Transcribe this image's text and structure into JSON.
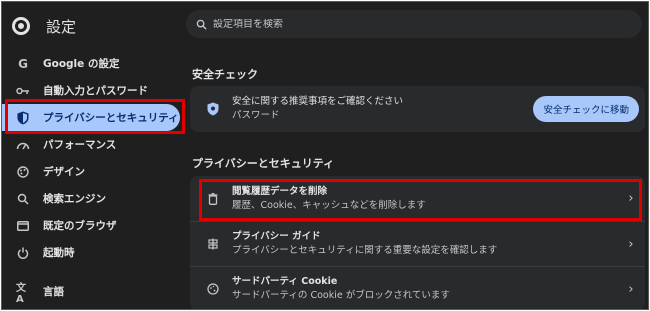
{
  "brand": {
    "title": "設定"
  },
  "search": {
    "placeholder": "設定項目を検索"
  },
  "sidebar": {
    "items": [
      {
        "label": "Google の設定",
        "icon": "google-g-icon"
      },
      {
        "label": "自動入力とパスワード",
        "icon": "key-icon"
      },
      {
        "label": "プライバシーとセキュリティ",
        "icon": "shield-icon",
        "active": true
      },
      {
        "label": "パフォーマンス",
        "icon": "speedometer-icon"
      },
      {
        "label": "デザイン",
        "icon": "palette-icon"
      },
      {
        "label": "検索エンジン",
        "icon": "search-icon"
      },
      {
        "label": "既定のブラウザ",
        "icon": "browser-window-icon"
      },
      {
        "label": "起動時",
        "icon": "power-icon"
      },
      {
        "label": "言語",
        "icon": "translate-icon"
      }
    ]
  },
  "safety_check": {
    "heading": "安全チェック",
    "title": "安全に関する推奨事項をご確認ください",
    "subtitle": "パスワード",
    "button": "安全チェックに移動"
  },
  "privacy": {
    "heading": "プライバシーとセキュリティ",
    "rows": [
      {
        "title": "閲覧履歴データを削除",
        "subtitle": "履歴、Cookie、キャッシュなどを削除します",
        "icon": "trash-icon"
      },
      {
        "title": "プライバシー ガイド",
        "subtitle": "プライバシーとセキュリティに関する重要な設定を確認します",
        "icon": "privacy-guide-icon"
      },
      {
        "title": "サードパーティ Cookie",
        "subtitle": "サードパーティの Cookie がブロックされています",
        "icon": "cookie-icon"
      }
    ]
  },
  "colors": {
    "accent": "#a8c7fa",
    "highlight": "#e00000",
    "background": "#1f1f1f",
    "card": "#282a2c"
  }
}
